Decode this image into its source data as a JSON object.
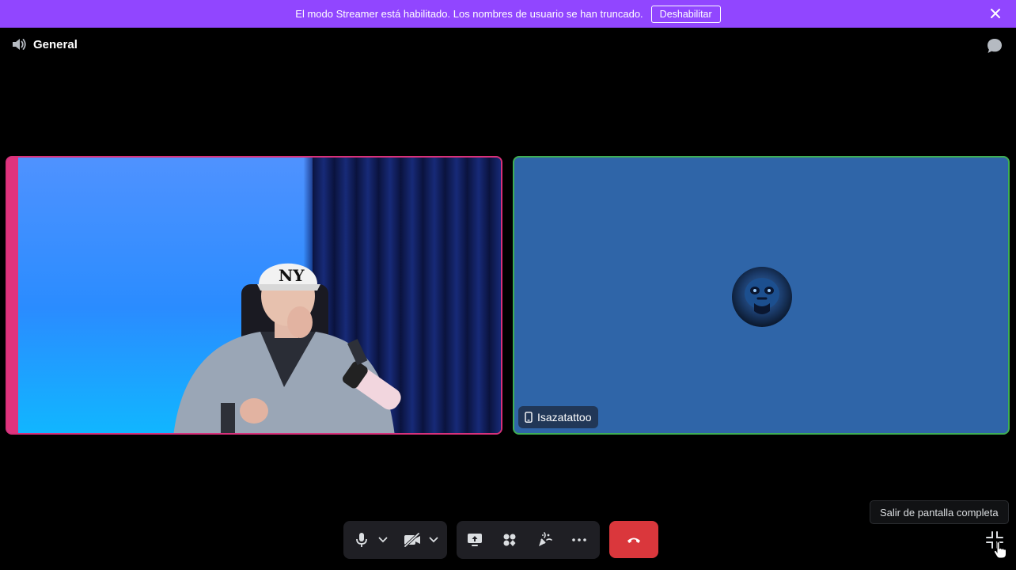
{
  "banner": {
    "message": "El modo Streamer está habilitado. Los nombres de usuario se han truncado.",
    "disable_label": "Deshabilitar",
    "close_icon": "close-icon",
    "color": "#9146ff"
  },
  "header": {
    "channel_name": "General",
    "channel_icon": "speaker-icon",
    "chat_icon": "chat-bubble-icon"
  },
  "tiles": [
    {
      "kind": "camera",
      "speaking_border": "#d8317a"
    },
    {
      "kind": "avatar",
      "username": "Isazatattoo",
      "device_icon": "mobile-phone-icon",
      "border": "#3fae54",
      "background": "#2f65a8"
    }
  ],
  "controls": {
    "mic_icon": "microphone-icon",
    "camera_icon": "camera-off-icon",
    "screenshare_icon": "screen-share-icon",
    "activities_icon": "activities-icon",
    "soundboard_icon": "soundboard-icon",
    "more_icon": "more-options-icon",
    "hangup_icon": "hang-up-icon",
    "hangup_color": "#da373c"
  },
  "tooltip": {
    "text": "Salir de pantalla completa"
  },
  "exit_fullscreen_icon": "exit-fullscreen-icon"
}
